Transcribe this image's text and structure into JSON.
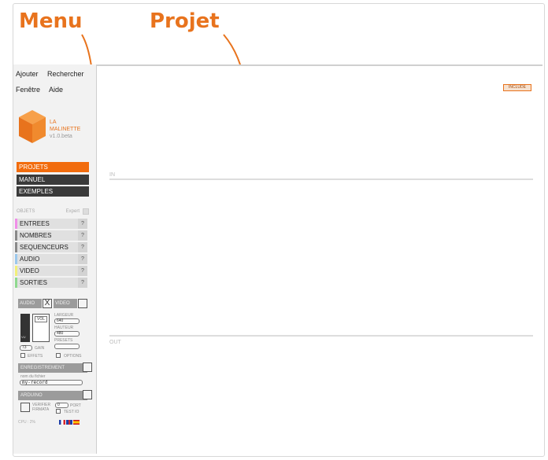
{
  "annotations": {
    "menu_label": "Menu",
    "project_label": "Projet"
  },
  "menubar": {
    "ajouter": "Ajouter",
    "rechercher": "Rechercher",
    "fenetre": "Fenêtre",
    "aide": "Aide"
  },
  "logo": {
    "line1": "LA",
    "line2": "MALINETTE",
    "version": "v1.0.beta"
  },
  "nav": {
    "projets": "PROJETS",
    "manuel": "MANUEL",
    "exemples": "EXEMPLES"
  },
  "objets": {
    "header": "OBJETS",
    "expert": "Expert",
    "items": [
      {
        "label": "ENTREES",
        "color": "#f08ee8"
      },
      {
        "label": "NOMBRES",
        "color": "#8a8a8a"
      },
      {
        "label": "SEQUENCEURS",
        "color": "#8a8a8a"
      },
      {
        "label": "AUDIO",
        "color": "#9cc8ec"
      },
      {
        "label": "VIDEO",
        "color": "#f2ef7a"
      },
      {
        "label": "SORTIES",
        "color": "#8fd98f"
      }
    ],
    "help": "?"
  },
  "av": {
    "audio": "AUDIO",
    "video": "VIDEO",
    "audio_toggle": "X",
    "vol": "VOL",
    "vu": "VU",
    "largeur_label": "LARGEUR",
    "largeur_value": "640",
    "hauteur_label": "HAUTEUR",
    "hauteur_value": "480",
    "presets_label": "PRESETS",
    "gain_value": "73",
    "gain_label": "GAIN",
    "effets": "EFFETS",
    "options": "OPTIONS"
  },
  "enregistrement": {
    "header": "ENREGISTREMENT",
    "file_label": "nom du fichier",
    "file_value": "my-record"
  },
  "arduino": {
    "header": "ARDUINO",
    "verifier": "VERIFIER",
    "firmata": "FIRMATA",
    "port_value": "0",
    "port_label": "PORT",
    "test": "TEST IO"
  },
  "footer": {
    "cpu": "CPU : 2%"
  },
  "project": {
    "include": "INCLUDE",
    "in": "IN",
    "out": "OUT"
  }
}
